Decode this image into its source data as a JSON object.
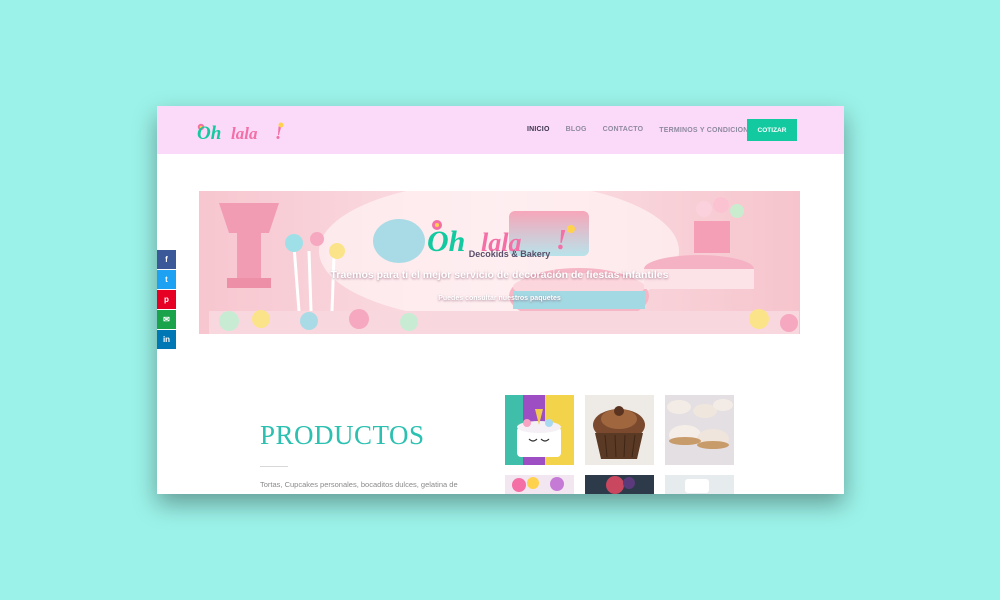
{
  "brand": {
    "logo_text": "Oh lala!",
    "tagline": "Decokids & Bakery",
    "colors": {
      "teal": "#13c9a0",
      "pink": "#f36fa6",
      "nav_bg": "#fbd9f8",
      "page_bg": "#9bf2e8"
    }
  },
  "nav": {
    "items": [
      {
        "label": "INICIO",
        "active": true
      },
      {
        "label": "BLOG",
        "active": false
      },
      {
        "label": "CONTACTO",
        "active": false
      },
      {
        "label": "TERMINOS Y CONDICIONES",
        "active": false,
        "dropdown": true
      }
    ],
    "cta_label": "COTIZAR",
    "dropdown_icon": "chevron-down-icon"
  },
  "share": {
    "items": [
      {
        "network": "facebook",
        "glyph": "f",
        "color": "#3b5998"
      },
      {
        "network": "twitter",
        "glyph": "t",
        "color": "#1da1f2"
      },
      {
        "network": "pinterest",
        "glyph": "p",
        "color": "#e60023"
      },
      {
        "network": "email",
        "glyph": "✉",
        "color": "#1aa34a"
      },
      {
        "network": "linkedin",
        "glyph": "in",
        "color": "#0077b5"
      }
    ]
  },
  "hero": {
    "headline": "Traemos para ti el mejor servicio de decoración de fiestas infantiles",
    "link_text": "Puedes consultar nuestros paquetes"
  },
  "products": {
    "title": "PRODUCTOS",
    "description": "Tortas, Cupcakes personales, bocaditos dulces, gelatina de",
    "thumbnails": [
      {
        "name": "unicorn-cake"
      },
      {
        "name": "chocolate-cupcake"
      },
      {
        "name": "alfajores"
      },
      {
        "name": "rainbow-treats"
      },
      {
        "name": "berry-dessert"
      },
      {
        "name": "white-dessert"
      }
    ]
  }
}
